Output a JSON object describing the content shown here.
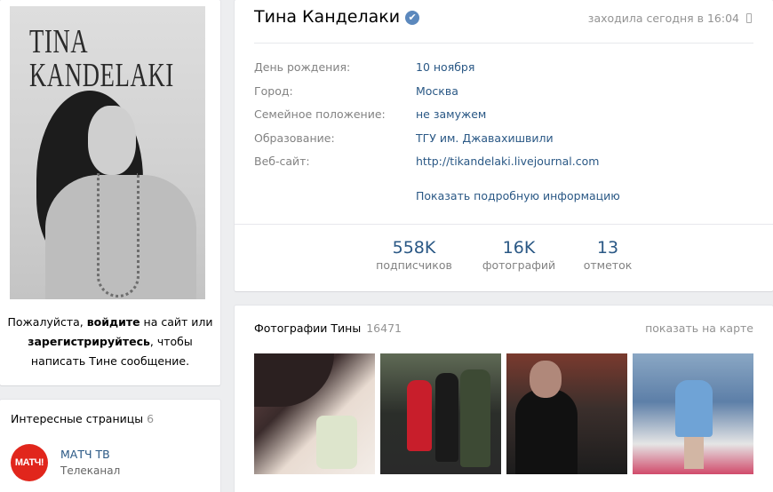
{
  "avatar": {
    "brand_line1": "TINA",
    "brand_line2": "KANDELAKI"
  },
  "login_message": {
    "part1": "Пожалуйста, ",
    "login_link": "войдите",
    "part2": " на сайт или ",
    "register_link": "зарегистрируйтесь",
    "part3": ", чтобы написать Тине сообщение."
  },
  "interesting_pages": {
    "title": "Интересные страницы",
    "count": "6",
    "items": [
      {
        "logo_text": "МАТЧ!",
        "name": "МАТЧ ТВ",
        "type": "Телеканал"
      }
    ]
  },
  "profile": {
    "name": "Тина Канделаки",
    "verified_icon": "check",
    "last_seen": "заходила сегодня в 16:04",
    "details": [
      {
        "label": "День рождения:",
        "value": "10 ноября"
      },
      {
        "label": "Город:",
        "value": "Москва"
      },
      {
        "label": "Семейное положение:",
        "value": "не замужем"
      },
      {
        "label": "Образование:",
        "value": "ТГУ им. Джавахишвили"
      },
      {
        "label": "Веб-сайт:",
        "value": "http://tikandelaki.livejournal.com"
      }
    ],
    "show_more": "Показать подробную информацию",
    "counters": [
      {
        "num": "558K",
        "label": "подписчиков"
      },
      {
        "num": "16K",
        "label": "фотографий"
      },
      {
        "num": "13",
        "label": "отметок"
      }
    ]
  },
  "photos": {
    "title": "Фотографии Тины",
    "count": "16471",
    "map_link": "показать на карте"
  },
  "colors": {
    "link": "#2a5885",
    "muted": "#939393",
    "label": "#828282",
    "accent_red": "#e1261c"
  }
}
